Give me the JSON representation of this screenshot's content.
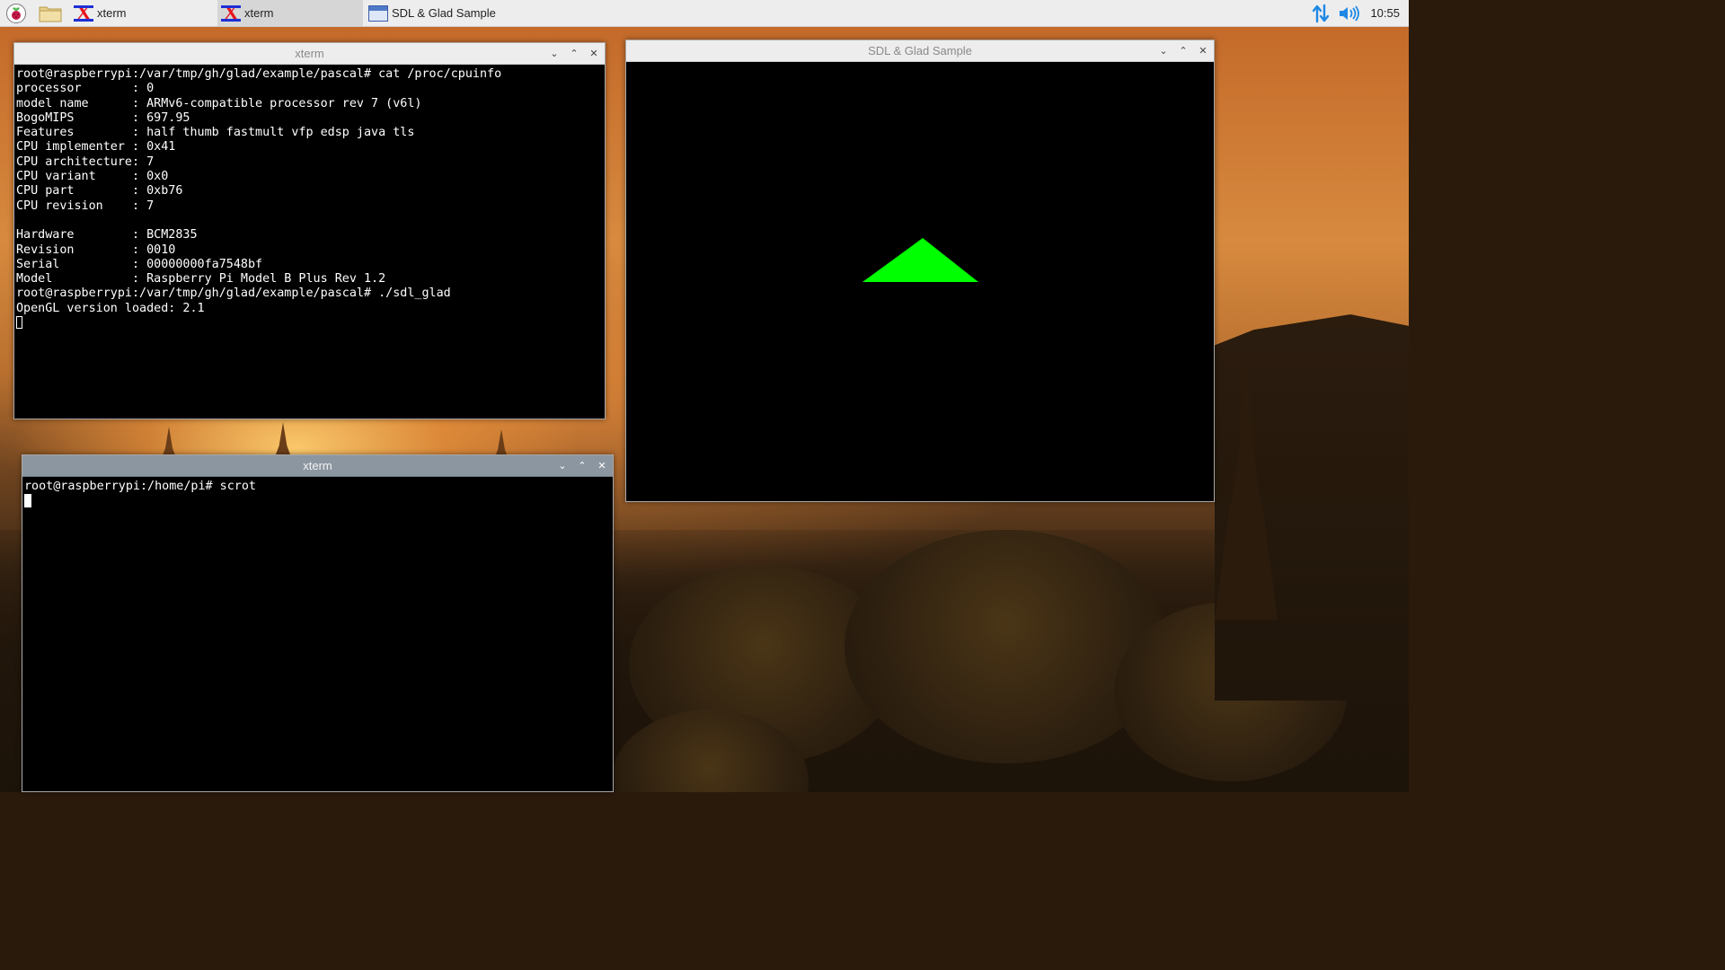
{
  "taskbar": {
    "menu_icon": "raspberry-icon",
    "file_manager_icon": "folder-icon",
    "tasks": [
      {
        "label": "xterm",
        "icon": "xterm-icon"
      },
      {
        "label": "xterm",
        "icon": "xterm-icon"
      },
      {
        "label": "SDL & Glad Sample",
        "icon": "window-icon"
      }
    ],
    "tray": {
      "network_icon": "network-transfer-icon",
      "volume_icon": "volume-icon",
      "clock": "10:55"
    }
  },
  "windows": {
    "xterm_top": {
      "title": "xterm",
      "lines": [
        "root@raspberrypi:/var/tmp/gh/glad/example/pascal# cat /proc/cpuinfo",
        "processor       : 0",
        "model name      : ARMv6-compatible processor rev 7 (v6l)",
        "BogoMIPS        : 697.95",
        "Features        : half thumb fastmult vfp edsp java tls",
        "CPU implementer : 0x41",
        "CPU architecture: 7",
        "CPU variant     : 0x0",
        "CPU part        : 0xb76",
        "CPU revision    : 7",
        "",
        "Hardware        : BCM2835",
        "Revision        : 0010",
        "Serial          : 00000000fa7548bf",
        "Model           : Raspberry Pi Model B Plus Rev 1.2",
        "root@raspberrypi:/var/tmp/gh/glad/example/pascal# ./sdl_glad",
        "OpenGL version loaded: 2.1"
      ]
    },
    "xterm_bottom": {
      "title": "xterm",
      "lines": [
        "root@raspberrypi:/home/pi# scrot"
      ]
    },
    "sdl": {
      "title": "SDL & Glad Sample",
      "triangle_color": "#00ff00"
    },
    "buttons": {
      "minimize": "⌄",
      "maximize": "⌃",
      "close": "✕"
    }
  }
}
